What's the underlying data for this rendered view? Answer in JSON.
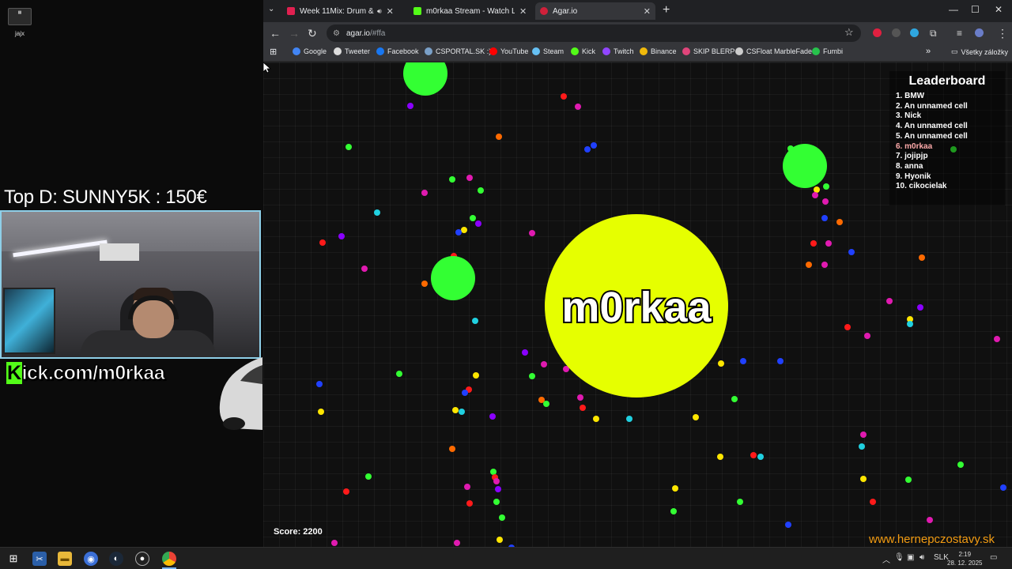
{
  "desktop": {
    "icon_label": "jajx"
  },
  "stream_overlay": {
    "promo_text": "Top D: SUNNY5K : 150€",
    "kick_k": "K",
    "kick_rest": "ick.com/m0rkaa"
  },
  "browser": {
    "tabs": [
      {
        "title": "Week 11Mix: Drum & Bass",
        "favicon_color": "#e02050",
        "active": false,
        "audio": true
      },
      {
        "title": "m0rkaa Stream - Watch Live on",
        "favicon_color": "#53fc18",
        "active": false,
        "audio": false
      },
      {
        "title": "Agar.io",
        "favicon_color": "#d0203a",
        "active": true,
        "audio": false
      }
    ],
    "url": "agar.io",
    "url_hash": "/#ffa",
    "bookmarks": [
      {
        "label": "Google",
        "color": "#4285f4"
      },
      {
        "label": "Tweeter",
        "color": "#dddddd"
      },
      {
        "label": "Facebook",
        "color": "#1877f2"
      },
      {
        "label": "CSPORTAL.SK :)",
        "color": "#7aa0c8"
      },
      {
        "label": "YouTube",
        "color": "#ff0000"
      },
      {
        "label": "Steam",
        "color": "#66c0f4"
      },
      {
        "label": "Kick",
        "color": "#53fc18"
      },
      {
        "label": "Twitch",
        "color": "#9146ff"
      },
      {
        "label": "Binance",
        "color": "#f0b90b"
      },
      {
        "label": "SKIP BLERP",
        "color": "#e0457b"
      },
      {
        "label": "CSFloat MarbleFade",
        "color": "#cccccc"
      },
      {
        "label": "Fumbi",
        "color": "#27c24c"
      }
    ],
    "all_bookmarks_label": "Všetky záložky"
  },
  "game": {
    "player_name": "m0rkaa",
    "player_color": "#e6ff00",
    "score_label": "Score: 2200",
    "leaderboard": {
      "title": "Leaderboard",
      "entries": [
        "1. BMW",
        "2. An unnamed cell",
        "3. Nick",
        "4. An unnamed cell",
        "5. An unnamed cell",
        "6. m0rkaa",
        "7. jojipjp",
        "8. anna",
        "9. Hyonik",
        "10. cikocielak"
      ],
      "highlight_rank": 6
    },
    "watermark": "www.hernepczostavy.sk",
    "cell_color": "#33ff33",
    "pellet_colors": [
      "#33ff33",
      "#ff0055",
      "#e01ab0",
      "#ffe600",
      "#2040ff",
      "#8a00ff",
      "#ff6a00",
      "#20d0e0",
      "#ff1a1a",
      "#7a00ff"
    ]
  },
  "taskbar": {
    "language": "SLK",
    "time": "2:19",
    "date": "28. 12. 2025"
  }
}
